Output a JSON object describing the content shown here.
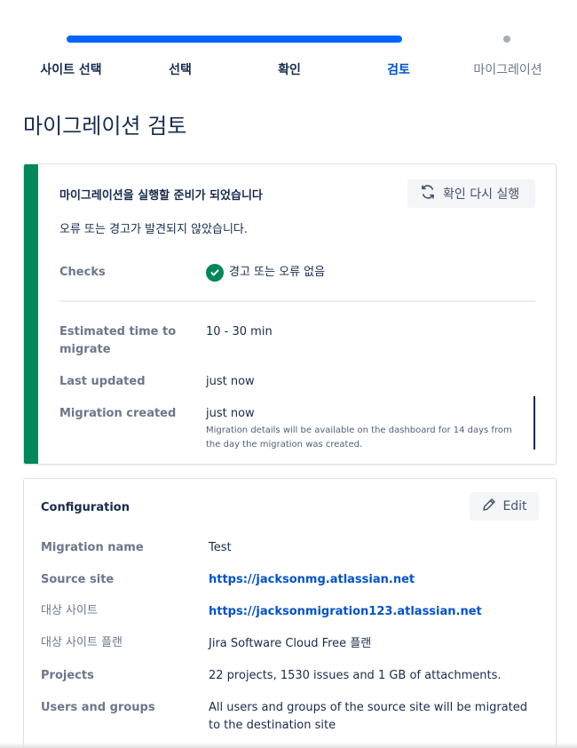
{
  "tracker": {
    "steps": [
      "사이트 선택",
      "선택",
      "확인",
      "검토",
      "마이그레이션"
    ],
    "active_color": "#0052cc",
    "progress_color": "#0065ff"
  },
  "page": {
    "title": "마이그레이션 검토"
  },
  "ready": {
    "title": "마이그레이션을 실행할 준비가 되었습니다",
    "rerun_label": "확인 다시 실행",
    "subtitle": "오류 또는 경고가 발견되지 않았습니다.",
    "accent_color": "#00875a",
    "rows": {
      "checks_label": "Checks",
      "checks_value": "경고 또는 오류 없음",
      "eta_label": "Estimated time to migrate",
      "eta_value": "10 - 30 min",
      "updated_label": "Last updated",
      "updated_value": "just now",
      "created_label": "Migration created",
      "created_value": "just now",
      "created_note": "Migration details will be available on the dashboard for 14 days from the day the migration was created."
    }
  },
  "config": {
    "title": "Configuration",
    "edit_label": "Edit",
    "rows": {
      "name_label": "Migration name",
      "name_value": "Test",
      "source_label": "Source site",
      "source_value": "https://jacksonmg.atlassian.net",
      "dest_label": "대상 사이트",
      "dest_value": "https://jacksonmigration123.atlassian.net",
      "plan_label": "대상 사이트 플랜",
      "plan_value": "Jira Software Cloud Free 플랜",
      "projects_label": "Projects",
      "projects_value": "22 projects, 1530 issues and 1 GB of attachments.",
      "users_label": "Users and groups",
      "users_value": "All users and groups of the source site will be migrated to the destination site"
    }
  }
}
